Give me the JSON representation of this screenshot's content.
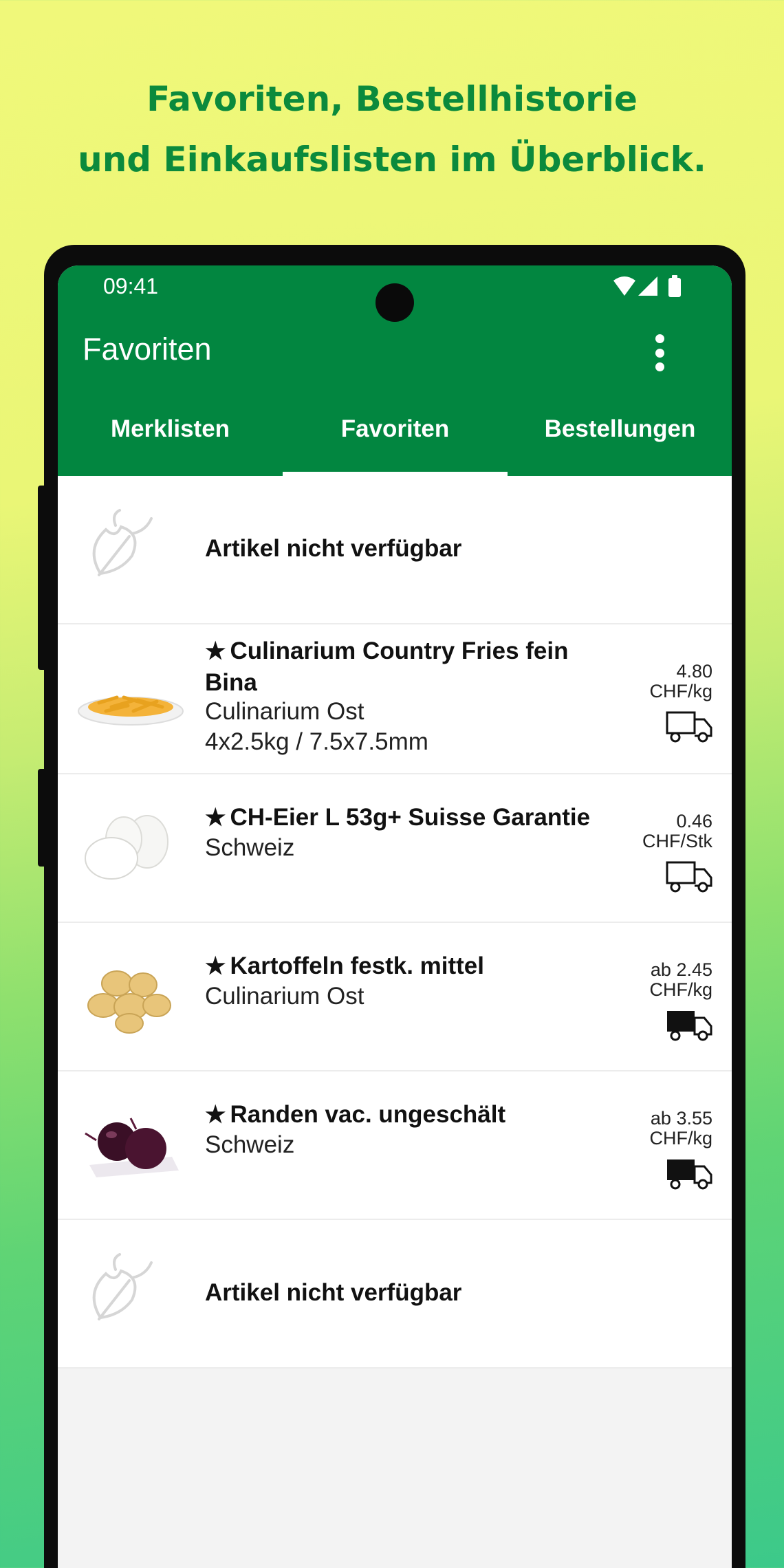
{
  "headline": {
    "line1": "Favoriten, Bestellhistorie",
    "line2": "und Einkaufslisten im Überblick."
  },
  "status_bar": {
    "time": "09:41",
    "icons": [
      "wifi-icon",
      "signal-icon",
      "battery-icon"
    ]
  },
  "app_bar": {
    "title": "Favoriten",
    "menu_icon": "more-vert-icon"
  },
  "tabs": [
    {
      "label": "Merklisten",
      "selected": false
    },
    {
      "label": "Favoriten",
      "selected": true
    },
    {
      "label": "Bestellungen",
      "selected": false
    }
  ],
  "items": [
    {
      "type": "unavailable",
      "label": "Artikel nicht verfügbar",
      "icon": "placeholder-leaf-icon"
    },
    {
      "type": "product",
      "star": "★",
      "name": "Culinarium Country Fries fein Bina",
      "subtitle": "Culinarium Ost",
      "subtitle2": "4x2.5kg / 7.5x7.5mm",
      "price": "4.80",
      "unit": "CHF/kg",
      "delivery_icon": "truck-outline-icon",
      "image": "fries"
    },
    {
      "type": "product",
      "star": "★",
      "name": "CH-Eier L 53g+ Suisse Garantie",
      "subtitle": "Schweiz",
      "price": "0.46",
      "unit": "CHF/Stk",
      "delivery_icon": "truck-outline-icon",
      "image": "eggs"
    },
    {
      "type": "product",
      "star": "★",
      "name": "Kartoffeln festk. mittel",
      "subtitle": "Culinarium Ost",
      "price": "ab 2.45",
      "unit": "CHF/kg",
      "delivery_icon": "truck-filled-icon",
      "image": "potatoes"
    },
    {
      "type": "product",
      "star": "★",
      "name": "Randen vac. ungeschält",
      "subtitle": "Schweiz",
      "price": "ab 3.55",
      "unit": "CHF/kg",
      "delivery_icon": "truck-filled-icon",
      "image": "beets"
    },
    {
      "type": "unavailable",
      "label": "Artikel nicht verfügbar",
      "icon": "placeholder-leaf-icon"
    }
  ],
  "colors": {
    "primary": "#028640",
    "headline": "#0b8a3c",
    "background_top": "#f0f87a",
    "background_bottom": "#3cc98a"
  }
}
